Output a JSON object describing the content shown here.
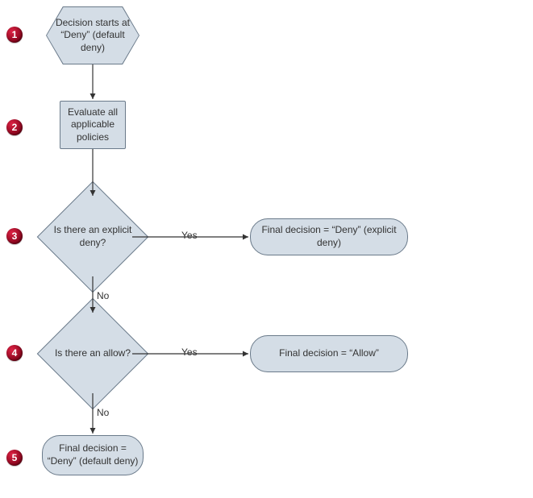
{
  "badges": {
    "b1": "1",
    "b2": "2",
    "b3": "3",
    "b4": "4",
    "b5": "5"
  },
  "nodes": {
    "start": "Decision starts at “Deny” (default deny)",
    "evaluate": "Evaluate all applicable policies",
    "explicit_deny_q": "Is there an explicit deny?",
    "allow_q": "Is there an allow?",
    "final_explicit_deny": "Final decision = “Deny” (explicit deny)",
    "final_allow": "Final decision = “Allow”",
    "final_default_deny": "Final decision = “Deny” (default deny)"
  },
  "edges": {
    "yes1": "Yes",
    "no1": "No",
    "yes2": "Yes",
    "no2": "No"
  }
}
